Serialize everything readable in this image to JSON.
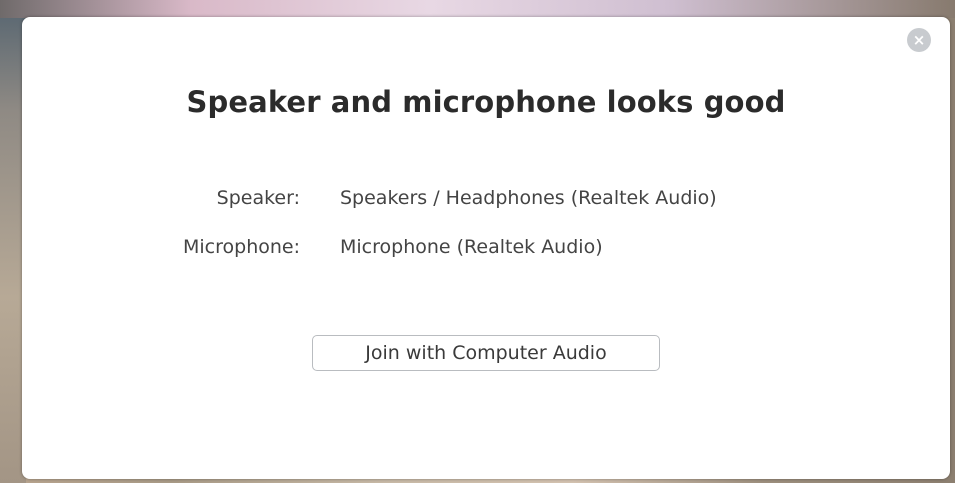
{
  "dialog": {
    "title": "Speaker and microphone looks good",
    "close_icon": "close-icon",
    "close_glyph": "×"
  },
  "devices": {
    "speaker_label": "Speaker:",
    "speaker_value": "Speakers / Headphones (Realtek Audio)",
    "microphone_label": "Microphone:",
    "microphone_value": "Microphone (Realtek Audio)"
  },
  "actions": {
    "join_label": "Join with Computer Audio"
  },
  "colors": {
    "dialog_background": "#ffffff",
    "title_text": "#2b2b2b",
    "body_text": "#444444",
    "button_border": "#b9bcc0",
    "close_button": "#c8cbcf"
  }
}
